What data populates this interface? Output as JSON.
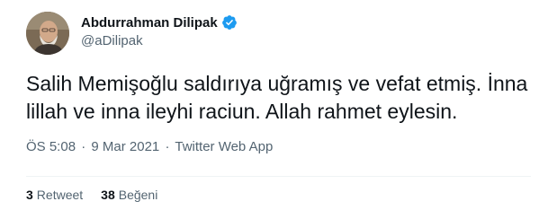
{
  "author": {
    "display_name": "Abdurrahman Dilipak",
    "handle": "@aDilipak",
    "verified_icon": "verified-badge-icon",
    "badge_color": "#1d9bf0"
  },
  "tweet": {
    "text": "Salih Memişoğlu saldırıya uğramış ve vefat etmiş. İnna lillah ve inna ileyhi raciun. Allah rahmet eylesin.",
    "time": "ÖS 5:08",
    "separator": "·",
    "date": "9 Mar 2021",
    "source": "Twitter Web App"
  },
  "stats": {
    "retweets": {
      "count": "3",
      "label": "Retweet"
    },
    "likes": {
      "count": "38",
      "label": "Beğeni"
    }
  }
}
